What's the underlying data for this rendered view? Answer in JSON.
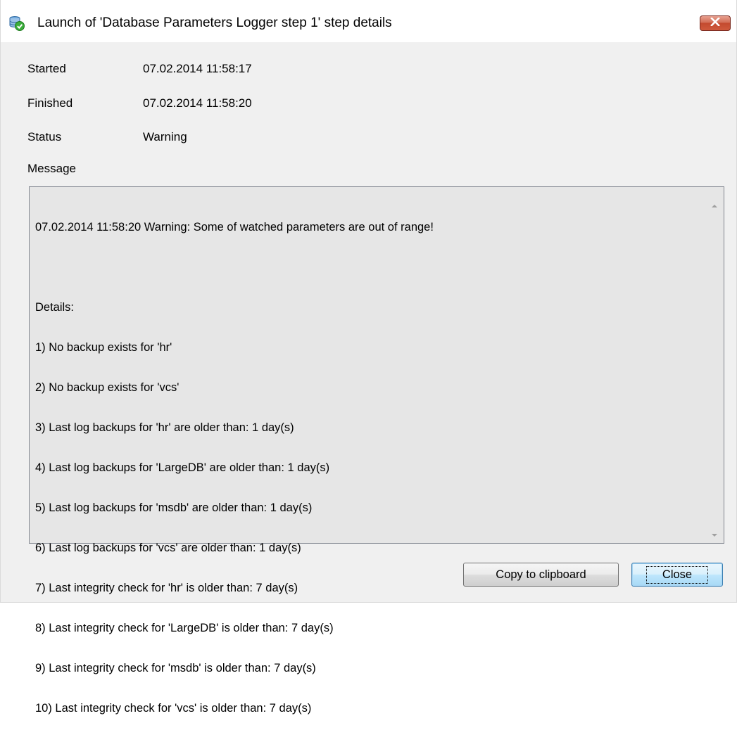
{
  "window": {
    "title": "Launch of 'Database Parameters Logger step 1' step details",
    "icon": "database-check-icon",
    "close_glyph": "✕"
  },
  "fields": {
    "started_label": "Started",
    "started_value": "07.02.2014 11:58:17",
    "finished_label": "Finished",
    "finished_value": "07.02.2014 11:58:20",
    "status_label": "Status",
    "status_value": "Warning",
    "message_label": "Message"
  },
  "message": {
    "lines": [
      "07.02.2014 11:58:20 Warning: Some of watched parameters are out of range!",
      "",
      "Details:",
      "1) No backup exists for 'hr'",
      "2) No backup exists for 'vcs'",
      "3) Last log backups for 'hr' are older than: 1 day(s)",
      "4) Last log backups for 'LargeDB' are older than: 1 day(s)",
      "5) Last log backups for 'msdb' are older than: 1 day(s)",
      "6) Last log backups for 'vcs' are older than: 1 day(s)",
      "7) Last integrity check for 'hr' is older than: 7 day(s)",
      "8) Last integrity check for 'LargeDB' is older than: 7 day(s)",
      "9) Last integrity check for 'msdb' is older than: 7 day(s)",
      "10) Last integrity check for 'vcs' is older than: 7 day(s)"
    ]
  },
  "buttons": {
    "copy_label": "Copy to clipboard",
    "close_label": "Close"
  },
  "colors": {
    "window_bg": "#f0f0f0",
    "message_bg": "#e6e6e6",
    "close_button_red": "#c34a2e",
    "status_warning": "#000000"
  }
}
